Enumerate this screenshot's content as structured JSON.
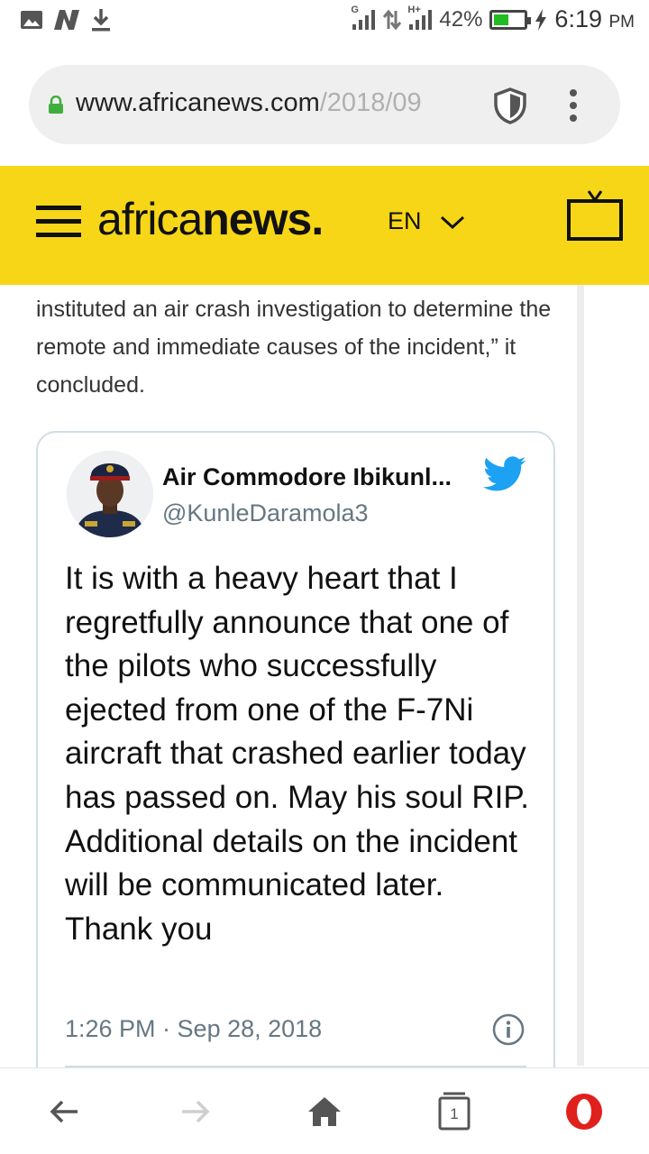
{
  "status_bar": {
    "battery": "42%",
    "battery_level": 0.42,
    "time": "6:19",
    "ampm": "PM",
    "sim1_label": "G",
    "sim2_label": "H+",
    "icons": [
      "image-icon",
      "n-app-icon",
      "download-icon",
      "signal-icon",
      "data-arrows-icon",
      "battery-icon",
      "charging-bolt-icon"
    ]
  },
  "url_bar": {
    "host": "www.africanews.com",
    "path": "/2018/09",
    "icons": [
      "lock-icon",
      "shield-icon",
      "kebab-menu-icon"
    ]
  },
  "header": {
    "logo_light": "africa",
    "logo_bold": "news.",
    "language": "EN",
    "bg_color": "#f7d618",
    "icons": [
      "hamburger-icon",
      "chevron-down-icon",
      "tv-icon"
    ]
  },
  "article": {
    "text": "instituted an air crash investigation to determine the remote and immediate causes of the incident,” it concluded."
  },
  "tweet": {
    "name": "Air Commodore Ibikunl...",
    "handle": "@KunleDaramola3",
    "body": "It is with a heavy heart that I regretfully announce that one of the pilots who successfully ejected from one of the F-7Ni aircraft that crashed earlier today has passed on. May his soul RIP. Additional details on the incident will be communicated later. Thank you",
    "timestamp": "1:26 PM · Sep 28, 2018",
    "accent_color": "#1da1f2",
    "icons": [
      "twitter-bird-icon",
      "info-icon"
    ]
  },
  "bottom_nav": {
    "tabs_count": "1",
    "icons": [
      "back-arrow-icon",
      "forward-arrow-icon",
      "home-icon",
      "tabs-icon",
      "opera-icon"
    ]
  }
}
